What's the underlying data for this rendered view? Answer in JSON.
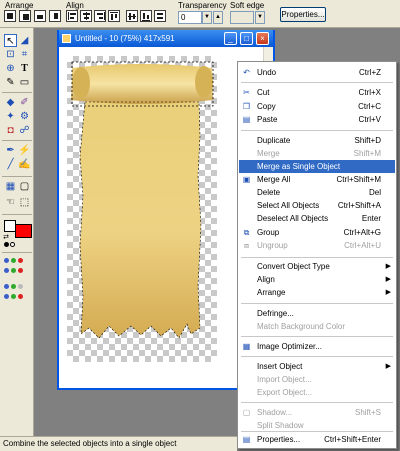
{
  "toolbar": {
    "arrange_label": "Arrange",
    "align_label": "Align",
    "transparency_label": "Transparency",
    "transparency_value": "0",
    "soft_edge_label": "Soft edge",
    "properties_button": "Properties..."
  },
  "document": {
    "title": "Untitled - 10 (75%) 417x591"
  },
  "menu": {
    "items": [
      {
        "label": "Undo",
        "shortcut": "Ctrl+Z",
        "icon": "undo-icon",
        "enabled": true
      },
      {
        "label": "Cut",
        "shortcut": "Ctrl+X",
        "icon": "scissors-icon",
        "enabled": true
      },
      {
        "label": "Copy",
        "shortcut": "Ctrl+C",
        "icon": "copy-icon",
        "enabled": true
      },
      {
        "label": "Paste",
        "shortcut": "Ctrl+V",
        "icon": "paste-icon",
        "enabled": true
      },
      {
        "label": "Duplicate",
        "shortcut": "Shift+D",
        "enabled": true
      },
      {
        "label": "Merge",
        "shortcut": "Shift+M",
        "enabled": false
      },
      {
        "label": "Merge as Single Object",
        "shortcut": "",
        "enabled": true,
        "highlighted": true
      },
      {
        "label": "Merge All",
        "shortcut": "Ctrl+Shift+M",
        "icon": "merge-all-icon",
        "enabled": true
      },
      {
        "label": "Delete",
        "shortcut": "Del",
        "enabled": true
      },
      {
        "label": "Select All Objects",
        "shortcut": "Ctrl+Shift+A",
        "enabled": true
      },
      {
        "label": "Deselect All Objects",
        "shortcut": "Enter",
        "enabled": true
      },
      {
        "label": "Group",
        "shortcut": "Ctrl+Alt+G",
        "icon": "group-icon",
        "enabled": true
      },
      {
        "label": "Ungroup",
        "shortcut": "Ctrl+Alt+U",
        "icon": "ungroup-icon",
        "enabled": false
      },
      {
        "label": "Convert Object Type",
        "submenu": true,
        "enabled": true
      },
      {
        "label": "Align",
        "submenu": true,
        "enabled": true
      },
      {
        "label": "Arrange",
        "submenu": true,
        "enabled": true
      },
      {
        "label": "Defringe...",
        "shortcut": "",
        "enabled": true
      },
      {
        "label": "Match Background Color",
        "shortcut": "",
        "enabled": false
      },
      {
        "label": "Image Optimizer...",
        "shortcut": "",
        "icon": "image-optimizer-icon",
        "enabled": true
      },
      {
        "label": "Insert Object",
        "submenu": true,
        "enabled": true
      },
      {
        "label": "Import Object...",
        "shortcut": "",
        "enabled": false
      },
      {
        "label": "Export Object...",
        "shortcut": "",
        "enabled": false
      },
      {
        "label": "Shadow...",
        "shortcut": "Shift+S",
        "icon": "shadow-icon",
        "enabled": false
      },
      {
        "label": "Split Shadow",
        "shortcut": "",
        "enabled": false
      },
      {
        "label": "Properties...",
        "shortcut": "Ctrl+Shift+Enter",
        "icon": "properties-icon",
        "enabled": true
      }
    ]
  },
  "status": {
    "text": "Combine the selected objects into a single object"
  },
  "colors": {
    "highlight": "#316ac5",
    "scroll_parchment": "#e9c96a",
    "foreground_swatch": "#ffffff",
    "background_swatch": "#ff0000"
  }
}
